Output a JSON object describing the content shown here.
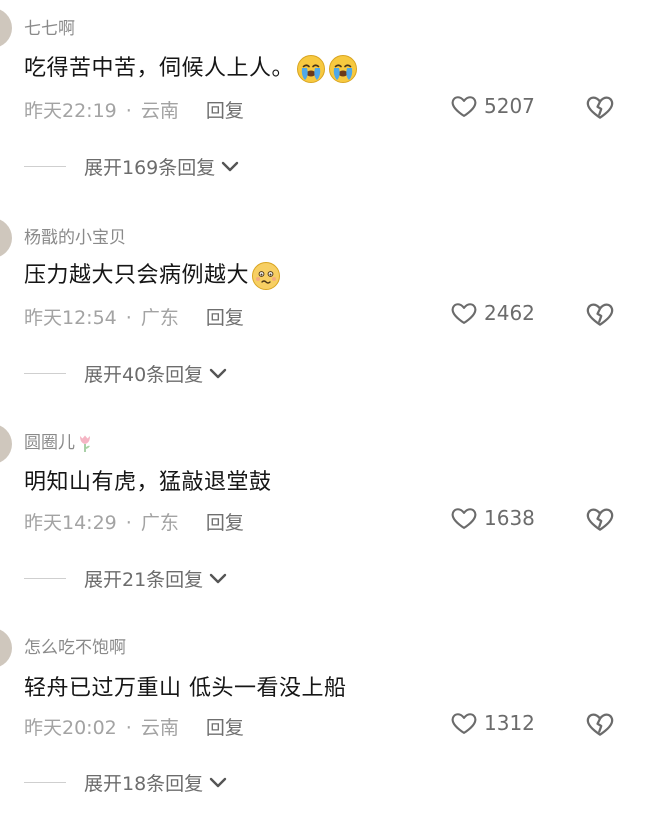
{
  "comments": [
    {
      "username": "七七啊",
      "content": "吃得苦中苦，伺候人上人。",
      "emoji": [
        "cry-emoji",
        "cry-emoji"
      ],
      "time": "昨天22:19",
      "location": "云南",
      "reply_label": "回复",
      "likes": "5207",
      "expand_label": "展开169条回复"
    },
    {
      "username": "杨戬的小宝贝",
      "content": "压力越大只会病例越大",
      "emoji": [
        "anxious-emoji"
      ],
      "time": "昨天12:54",
      "location": "广东",
      "reply_label": "回复",
      "likes": "2462",
      "expand_label": "展开40条回复"
    },
    {
      "username": "圆圈儿",
      "username_icon": "tulip-icon",
      "content": "明知山有虎，猛敲退堂鼓",
      "time": "昨天14:29",
      "location": "广东",
      "reply_label": "回复",
      "likes": "1638",
      "expand_label": "展开21条回复"
    },
    {
      "username": "怎么吃不饱啊",
      "content": "轻舟已过万重山 低头一看没上船",
      "time": "昨天20:02",
      "location": "云南",
      "reply_label": "回复",
      "likes": "1312",
      "expand_label": "展开18条回复"
    }
  ],
  "separator_dot": "·",
  "colors": {
    "background": "#ffffff",
    "username": "#8a8a8a",
    "content": "#161616",
    "meta": "#a3a3a3",
    "icon": "#6b6b6b"
  }
}
